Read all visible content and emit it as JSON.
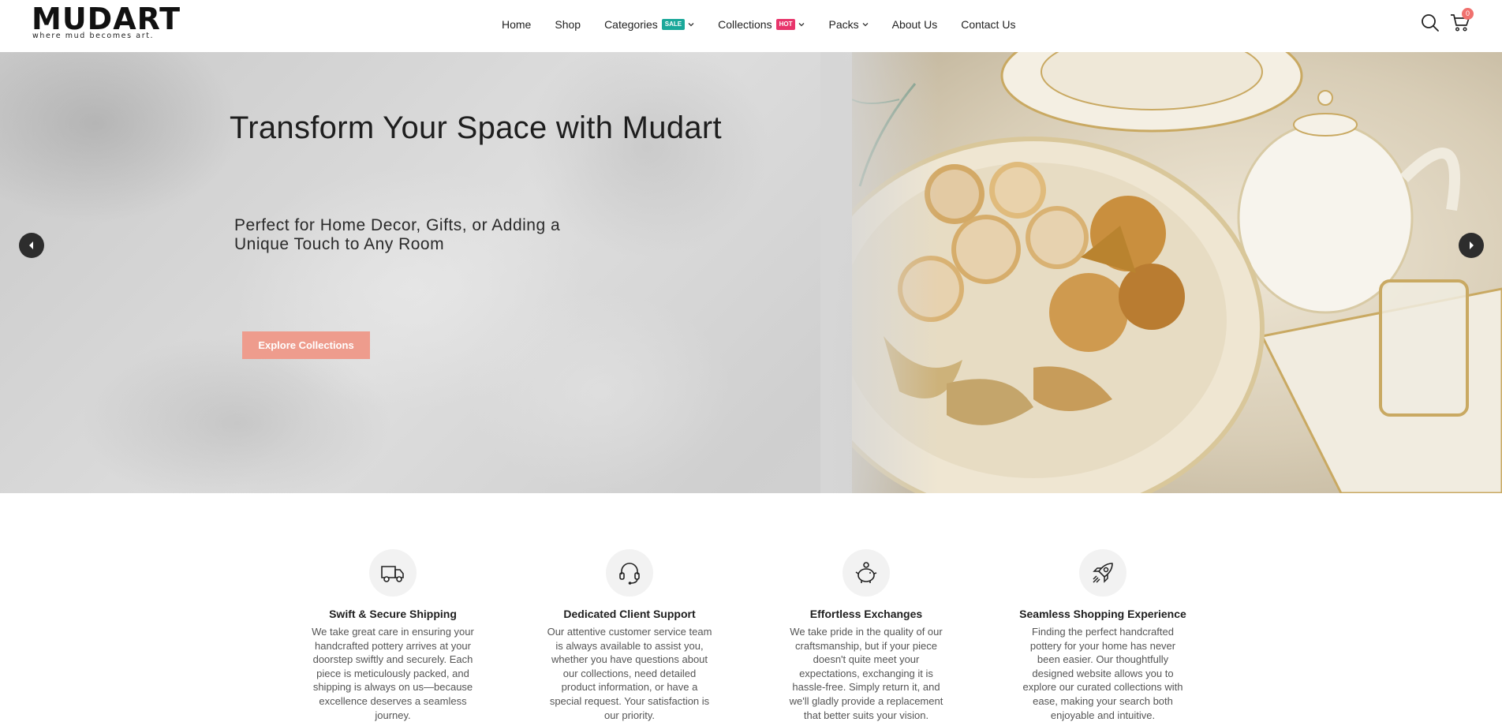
{
  "brand": {
    "name": "MUDART",
    "tagline": "where mud becomes art."
  },
  "nav": {
    "items": [
      {
        "label": "Home"
      },
      {
        "label": "Shop"
      },
      {
        "label": "Categories",
        "badge": "SALE",
        "badge_color": "#1aa89a",
        "has_dropdown": true
      },
      {
        "label": "Collections",
        "badge": "HOT",
        "badge_color": "#e8356b",
        "has_dropdown": true
      },
      {
        "label": "Packs",
        "has_dropdown": true
      },
      {
        "label": "About Us"
      },
      {
        "label": "Contact Us"
      }
    ]
  },
  "header_icons": {
    "search": "search-icon",
    "cart": "cart-icon",
    "cart_count": "0"
  },
  "hero": {
    "title": "Transform Your Space with Mudart",
    "subtitle": "Perfect for Home Decor, Gifts, or Adding a Unique Touch to Any Room",
    "button": "Explore Collections",
    "button_color": "#ee9c8d",
    "prev_icon": "chevron-left-icon",
    "next_icon": "chevron-right-icon"
  },
  "features": [
    {
      "icon": "truck-icon",
      "title": "Swift & Secure Shipping",
      "text": "We take great care in ensuring your handcrafted pottery arrives at your doorstep swiftly and securely. Each piece is meticulously packed, and shipping is always on us—because excellence deserves a seamless journey."
    },
    {
      "icon": "headset-icon",
      "title": "Dedicated Client Support",
      "text": "Our attentive customer service team is always available to assist you, whether you have questions about our collections, need detailed product information, or have a special request. Your satisfaction is our priority."
    },
    {
      "icon": "piggy-bank-icon",
      "title": "Effortless Exchanges",
      "text": "We take pride in the quality of our craftsmanship, but if your piece doesn't quite meet your expectations, exchanging it is hassle-free. Simply return it, and we'll gladly provide a replacement that better suits your vision."
    },
    {
      "icon": "rocket-icon",
      "title": "Seamless Shopping Experience",
      "text": "Finding the perfect handcrafted pottery for your home has never been easier. Our thoughtfully designed website allows you to explore our curated collections with ease, making your search both enjoyable and intuitive."
    }
  ]
}
